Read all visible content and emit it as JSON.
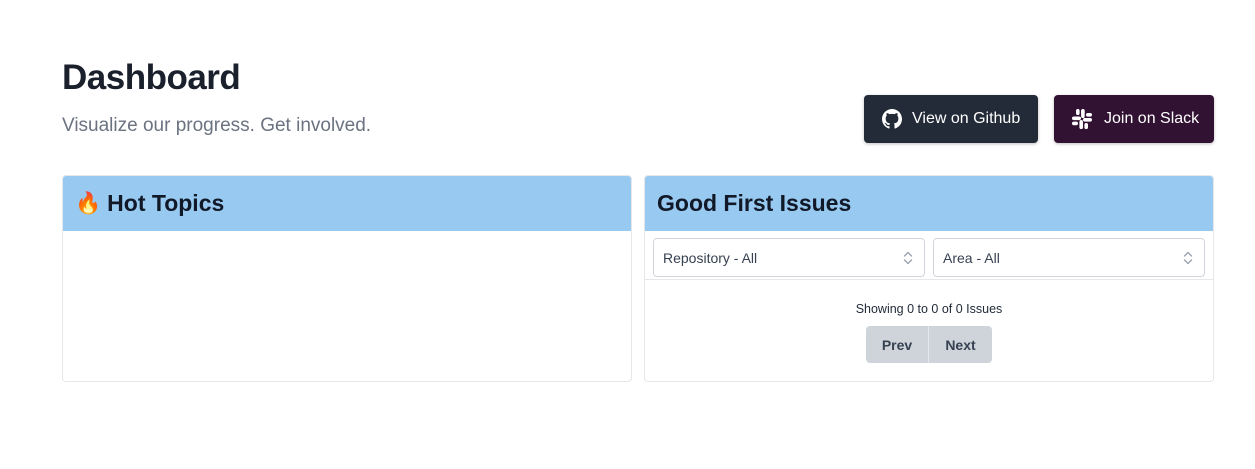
{
  "header": {
    "title": "Dashboard",
    "subtitle": "Visualize our progress. Get involved."
  },
  "actions": {
    "github_label": "View on Github",
    "slack_label": "Join on Slack"
  },
  "hot_topics": {
    "icon": "fire-icon",
    "emoji": "🔥",
    "title": "Hot Topics"
  },
  "good_first_issues": {
    "title": "Good First Issues",
    "filters": {
      "repository": "Repository - All",
      "area": "Area - All"
    },
    "pagination": {
      "status": "Showing 0 to 0 of 0 Issues",
      "prev_label": "Prev",
      "next_label": "Next"
    }
  },
  "colors": {
    "github_button": "#222b37",
    "slack_button": "#321233",
    "card_header": "#98c9f0"
  }
}
